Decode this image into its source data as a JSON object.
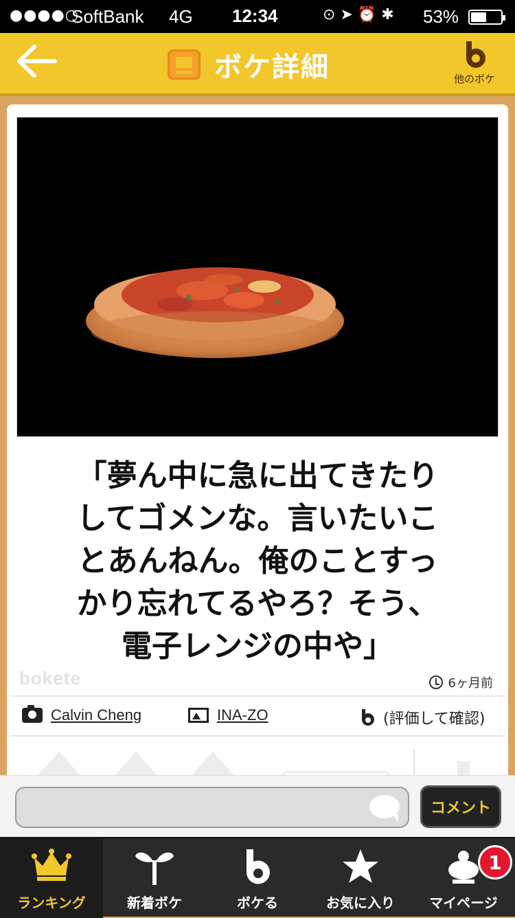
{
  "status_bar": {
    "signal": "●●●●○",
    "carrier": "SoftBank",
    "network": "4G",
    "time": "12:34",
    "battery_percent": "53%",
    "battery_level": 0.53
  },
  "nav": {
    "title": "ボケ詳細",
    "other_boke_label": "他のボケ"
  },
  "post": {
    "caption_lines": [
      "「夢ん中に急に出てきたり",
      "してゴメンな。言いたいこ",
      "とあんねん。俺のことすっ",
      "かり忘れてるやろ？そう、",
      "電子レンジの中や」"
    ],
    "watermark": "bokete",
    "time_ago": "6ヶ月前",
    "photographer": "Calvin Cheng",
    "image_author": "INA-ZO",
    "rating_text": "(評価して確認)"
  },
  "comment": {
    "placeholder": "",
    "button_label": "コメント"
  },
  "tabs": [
    {
      "label": "ランキング",
      "icon": "crown-icon",
      "active": true
    },
    {
      "label": "新着ボケ",
      "icon": "sprout-icon",
      "active": false
    },
    {
      "label": "ボケる",
      "icon": "b-logo-icon",
      "active": false
    },
    {
      "label": "お気に入り",
      "icon": "star-icon",
      "active": false
    },
    {
      "label": "マイページ",
      "icon": "mypage-icon",
      "active": false,
      "badge": "1"
    }
  ],
  "colors": {
    "accent": "#f2c72b",
    "badge": "#e6162d",
    "tab_bar": "#2a2a2a"
  }
}
